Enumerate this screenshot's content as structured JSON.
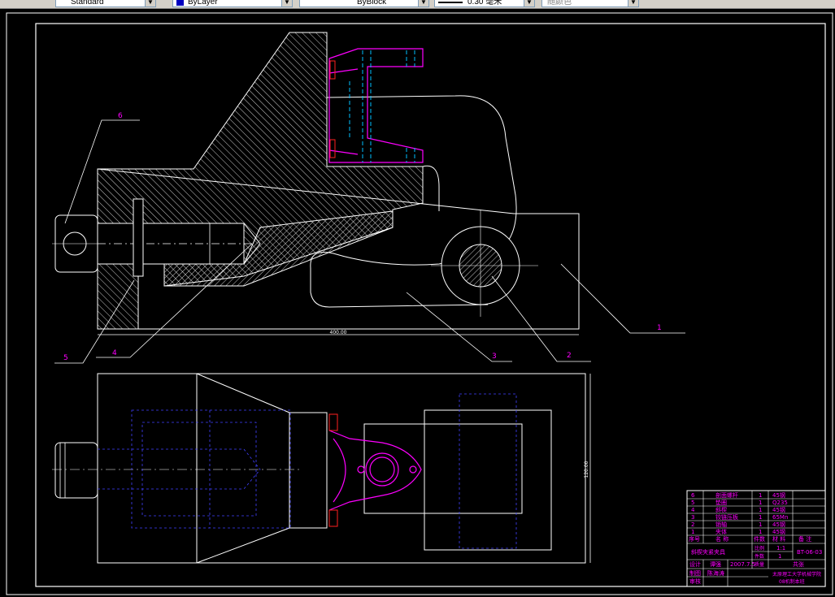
{
  "toolbar": {
    "text_style": "Standard",
    "layer": "ByLayer",
    "linetype": "ByBlock",
    "lineweight": "0.30 毫米",
    "plot_style": "随颜色"
  },
  "drawing": {
    "balloons": [
      "1",
      "2",
      "3",
      "4",
      "5",
      "6"
    ],
    "dim_overall_length": "400.00",
    "dim_width": "120.00"
  },
  "title_block": {
    "parts": [
      {
        "no": "6",
        "name": "剖面螺杆",
        "qty": "1",
        "material": "45钢"
      },
      {
        "no": "5",
        "name": "垫圈",
        "qty": "1",
        "material": "Q235"
      },
      {
        "no": "4",
        "name": "斜楔",
        "qty": "1",
        "material": "45钢"
      },
      {
        "no": "3",
        "name": "铰链压板",
        "qty": "1",
        "material": "65Mn"
      },
      {
        "no": "2",
        "name": "销轴",
        "qty": "1",
        "material": "45钢"
      },
      {
        "no": "1",
        "name": "夹体",
        "qty": "1",
        "material": "45钢"
      }
    ],
    "header": {
      "no": "序号",
      "name": "名 称",
      "qty": "件数",
      "material": "材 料",
      "note": "备 注"
    },
    "assembly_name": "斜楔夹紧夹具",
    "scale_label": "比例",
    "scale": "1:1",
    "count_label": "件数",
    "count": "1",
    "drawing_no": "BT-06-03",
    "designer_label": "设计",
    "designer": "谭强",
    "date": "2007.7.5",
    "check_label": "审核",
    "check": "",
    "weight_label": "质量",
    "sheet_label": "共张",
    "drawn_label": "制图",
    "drawn": "陈海涛",
    "approve_label": "审核",
    "school": "太原理工大学机械学院",
    "class": "08机制本班"
  }
}
